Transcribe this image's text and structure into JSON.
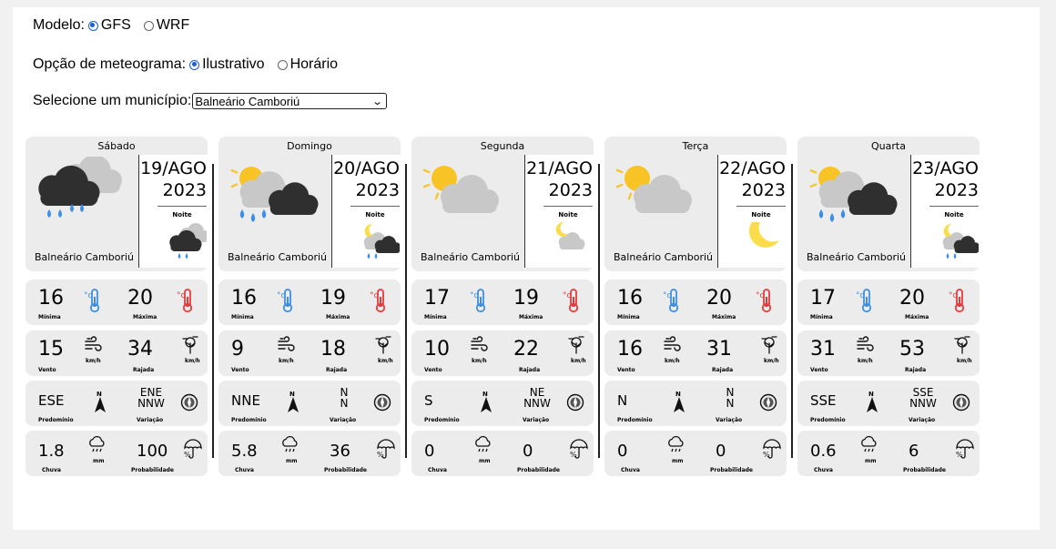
{
  "controls": {
    "modelo_label": "Modelo:",
    "modelo_options": [
      "GFS",
      "WRF"
    ],
    "opcao_label": "Opção de meteograma:",
    "opcao_options": [
      "Ilustrativo",
      "Horário"
    ],
    "municipio_label": "Selecione um município:",
    "municipio_value": "Balneário Camboriú"
  },
  "labels": {
    "noite": "Noite",
    "minima": "Mínima",
    "maxima": "Máxima",
    "vento": "Vento",
    "rajada": "Rajada",
    "predominio": "Predomínio",
    "variacao": "Variação",
    "chuva": "Chuva",
    "probabilidade": "Probabilidade",
    "kmh": "km/h",
    "mm": "mm"
  },
  "days": [
    {
      "name": "Sábado",
      "date": "19/AGO",
      "year": "2023",
      "city": "Balneário Camboriú",
      "day_icon": "rain-cloud-icon",
      "night_icon": "night-rain-cloud-icon",
      "min": "16",
      "max": "20",
      "vento": "15",
      "rajada": "34",
      "predominio": "ESE",
      "variacao": [
        "ENE",
        "NNW"
      ],
      "chuva": "1.8",
      "prob": "100"
    },
    {
      "name": "Domingo",
      "date": "20/AGO",
      "year": "2023",
      "city": "Balneário Camboriú",
      "day_icon": "sun-rain-cloud-icon",
      "night_icon": "moon-rain-cloud-icon",
      "min": "16",
      "max": "19",
      "vento": "9",
      "rajada": "18",
      "predominio": "NNE",
      "variacao": [
        "N",
        "N"
      ],
      "chuva": "5.8",
      "prob": "36"
    },
    {
      "name": "Segunda",
      "date": "21/AGO",
      "year": "2023",
      "city": "Balneário Camboriú",
      "day_icon": "sun-cloud-icon",
      "night_icon": "moon-cloud-icon",
      "min": "17",
      "max": "19",
      "vento": "10",
      "rajada": "22",
      "predominio": "S",
      "variacao": [
        "NE",
        "NNW"
      ],
      "chuva": "0",
      "prob": "0"
    },
    {
      "name": "Terça",
      "date": "22/AGO",
      "year": "2023",
      "city": "Balneário Camboriú",
      "day_icon": "sun-cloud-icon",
      "night_icon": "moon-icon",
      "min": "16",
      "max": "20",
      "vento": "16",
      "rajada": "31",
      "predominio": "N",
      "variacao": [
        "N",
        "N"
      ],
      "chuva": "0",
      "prob": "0"
    },
    {
      "name": "Quarta",
      "date": "23/AGO",
      "year": "2023",
      "city": "Balneário Camboriú",
      "day_icon": "sun-rain-cloud-icon",
      "night_icon": "moon-rain-cloud-icon",
      "min": "17",
      "max": "20",
      "vento": "31",
      "rajada": "53",
      "predominio": "SSE",
      "variacao": [
        "SSE",
        "NNW"
      ],
      "chuva": "0.6",
      "prob": "6"
    }
  ],
  "colors": {
    "thermo_min": "#3d8fe6",
    "thermo_max": "#e63a3a",
    "sun": "#f7c325",
    "cloud_light": "#c8c8c8",
    "cloud_dark": "#2f2f2f",
    "rain": "#3d8fe6",
    "moon": "#fbdc4b"
  }
}
